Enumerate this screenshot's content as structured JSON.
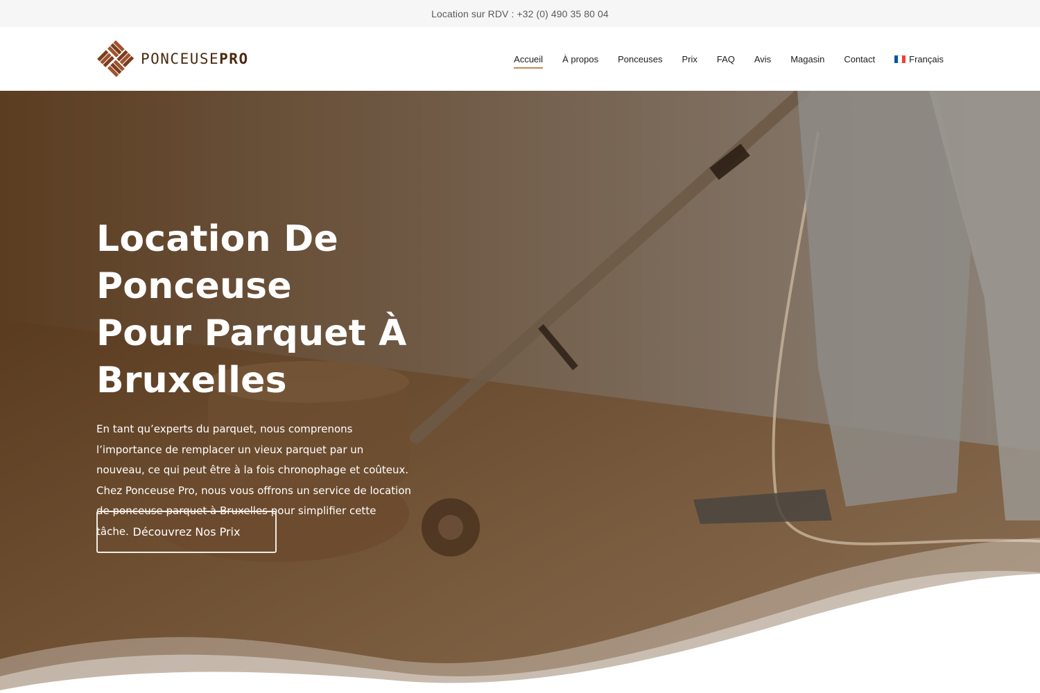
{
  "topbar": {
    "text": "Location sur RDV : +32 (0) 490 35 80 04"
  },
  "logo": {
    "text_light": "PONCEUSE",
    "text_bold": "PRO",
    "icon": "parquet-logo-icon"
  },
  "nav": {
    "items": [
      {
        "label": "Accueil",
        "active": true
      },
      {
        "label": "À propos"
      },
      {
        "label": "Ponceuses"
      },
      {
        "label": "Prix"
      },
      {
        "label": "FAQ"
      },
      {
        "label": "Avis"
      },
      {
        "label": "Magasin"
      },
      {
        "label": "Contact"
      },
      {
        "label": "Français",
        "icon": "french-flag-icon"
      }
    ]
  },
  "hero": {
    "title_lines": [
      "Location De Ponceuse",
      "Pour Parquet À",
      "Bruxelles"
    ],
    "text": "En tant qu’experts du parquet, nous comprenons l’importance de remplacer un vieux parquet par un nouveau, ce qui peut être à la fois chronophage et coûteux. Chez Ponceuse Pro, nous vous offrons un service de location de ponceuse parquet à Bruxelles pour simplifier cette tâche.",
    "button_label": "Découvrez Nos Prix"
  },
  "colors": {
    "accent": "#c8874f",
    "logo_brown": "#4a2a12",
    "hero_overlay": "#5e3f22",
    "topbar_bg": "#f6f6f6"
  }
}
